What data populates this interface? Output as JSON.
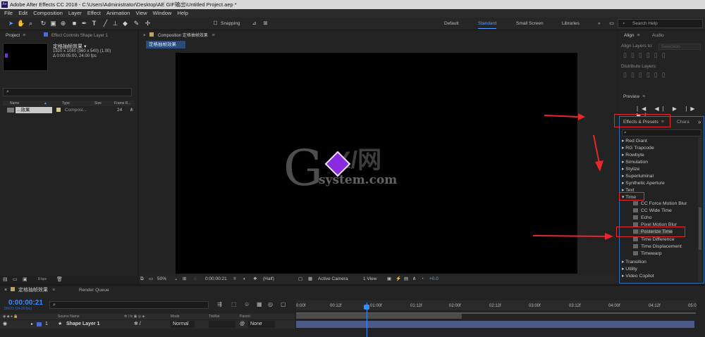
{
  "titlebar": {
    "text": "Adobe After Effects CC 2018 - C:\\Users\\Administrator\\Desktop\\AE GIF输出\\Untitled Project.aep *",
    "icon": "Ae"
  },
  "menubar": {
    "items": [
      "File",
      "Edit",
      "Composition",
      "Layer",
      "Effect",
      "Animation",
      "View",
      "Window",
      "Help"
    ]
  },
  "toolbar": {
    "snapping": "Snapping",
    "workspaces": [
      "Default",
      "Standard",
      "Small Screen",
      "Libraries"
    ],
    "search_placeholder": "Search Help"
  },
  "project": {
    "tab": "Project",
    "effect_controls_tab": "Effect Controls Shape Layer 1",
    "comp_name": "定格抽帧效果 ▾",
    "comp_info1": "1920 x 1080 (960 x 540) (1.00)",
    "comp_info2": "Δ 0:00:05:00, 24.00 fps",
    "search": "⌕",
    "cols": {
      "name": "Name",
      "type": "Type",
      "size": "Size",
      "frame": "Frame R..."
    },
    "row": {
      "name": "...效果",
      "type": "Composi...",
      "frame": "24"
    },
    "bpc": "8 bpc"
  },
  "composition": {
    "tab": "Composition 定格抽帧效果",
    "subtab": "定格抽帧效果",
    "zoom": "50%",
    "time": "0:00:00:21",
    "resolution": "(Half)",
    "camera": "Active Camera",
    "views": "1 View",
    "exposure": "+0.0"
  },
  "watermark": {
    "g": "G",
    "xi": "X/网",
    "system": "system.com"
  },
  "align": {
    "tab": "Align",
    "audio_tab": "Audio",
    "align_layers": "Align Layers to:",
    "selection": "Selection",
    "distribute": "Distribute Layers:"
  },
  "preview": {
    "tab": "Preview",
    "controls": "|◀ ◀| ▶ |▶ ▶|"
  },
  "effects": {
    "tab": "Effects & Presets",
    "char_tab": "Chara",
    "search": "⌕",
    "categories": [
      "▸ Red Giant",
      "▸ RG Trapcode",
      "▸ Rowbyte",
      "▸ Simulation",
      "▸ Stylize",
      "▸ Superluminal",
      "▸ Synthetic Aperture",
      "▸ Text",
      "▾ Time"
    ],
    "time_children": [
      "CC Force Motion Blur",
      "CC Wide Time",
      "Echo",
      "Pixel Motion Blur",
      "Posterize Time",
      "Time Difference",
      "Time Displacement",
      "Timewarp"
    ],
    "after": [
      "▸ Transition",
      "▸ Utility",
      "▸ Video Copilot"
    ]
  },
  "timeline": {
    "tab": "定格抽帧效果",
    "render_queue": "Render Queue",
    "timecode": "0:00:00:21",
    "fps": "00021 (24.00 fps)",
    "search": "⌕",
    "ticks": [
      "0:00f",
      "00:12f",
      "01:00f",
      "01:12f",
      "02:00f",
      "02:12f",
      "03:00f",
      "03:12f",
      "04:00f",
      "04:12f",
      "05:0"
    ],
    "cols": {
      "source": "Source Name",
      "mode": "Mode",
      "trkmat": "TrkMat",
      "parent": "Parent"
    },
    "layer": {
      "num": "1",
      "name": "Shape Layer 1",
      "mode": "Normal",
      "parent": "None"
    }
  },
  "colors": {
    "accent": "#3b8bff",
    "highlight": "#e8262b",
    "diamond": "#8a2be2"
  }
}
